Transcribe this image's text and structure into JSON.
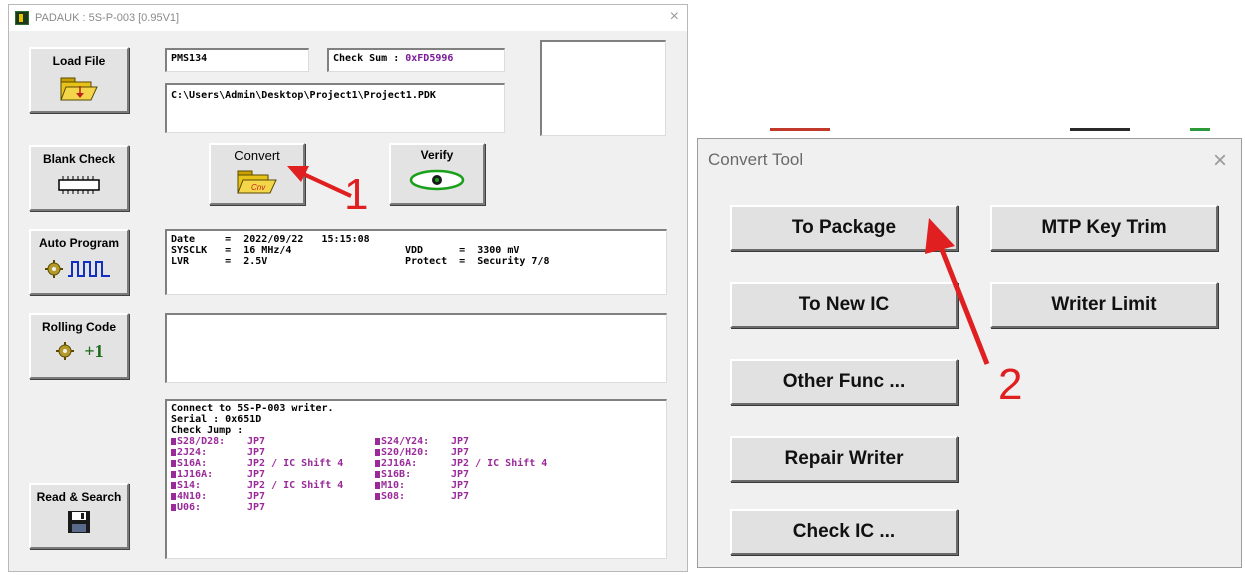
{
  "window": {
    "title": "PADAUK : 5S-P-003 [0.95V1]",
    "close_glyph": "×"
  },
  "side_buttons": {
    "load_file": "Load File",
    "blank_check": "Blank Check",
    "auto_program": "Auto Program",
    "rolling_code": "Rolling Code",
    "rolling_code_suffix": "+1",
    "read_search": "Read & Search"
  },
  "header": {
    "ic_name": "PMS134",
    "checksum_label": "Check Sum : ",
    "checksum_value": "0xFD5996",
    "file_path": "C:\\Users\\Admin\\Desktop\\Project1\\Project1.PDK"
  },
  "actions": {
    "convert": "Convert",
    "verify": "Verify"
  },
  "info": {
    "row1_left": "Date     =  2022/09/22   15:15:08",
    "row2_left": "SYSCLK   =  16 MHz/4",
    "row2_right": "VDD      =  3300 mV",
    "row3_left": "LVR      =  2.5V",
    "row3_right": "Protect  =  Security 7/8"
  },
  "log": {
    "lines": [
      "Connect to 5S-P-003 writer.",
      "Serial : 0x651D",
      "Check Jump :"
    ],
    "jumps_left": [
      {
        "pkg": "S28/D28:",
        "val": "JP7"
      },
      {
        "pkg": "2J24:",
        "val": "JP7"
      },
      {
        "pkg": "S16A:",
        "val": "JP2 / IC Shift 4"
      },
      {
        "pkg": "1J16A:",
        "val": "JP7"
      },
      {
        "pkg": "S14:",
        "val": "JP2 / IC Shift 4"
      },
      {
        "pkg": "4N10:",
        "val": "JP7"
      },
      {
        "pkg": "U06:",
        "val": "JP7"
      }
    ],
    "jumps_right": [
      {
        "pkg": "S24/Y24:",
        "val": "JP7"
      },
      {
        "pkg": "S20/H20:",
        "val": "JP7"
      },
      {
        "pkg": "2J16A:",
        "val": "JP2 / IC Shift 4"
      },
      {
        "pkg": "S16B:",
        "val": "JP7"
      },
      {
        "pkg": "M10:",
        "val": "JP7"
      },
      {
        "pkg": "S08:",
        "val": "JP7"
      }
    ]
  },
  "convert_tool": {
    "title": "Convert Tool",
    "close_glyph": "×",
    "buttons": {
      "to_package": "To Package",
      "mtp_key_trim": "MTP Key Trim",
      "to_new_ic": "To New IC",
      "writer_limit": "Writer Limit",
      "other_func": "Other Func ...",
      "repair_writer": "Repair Writer",
      "check_ic": "Check IC ..."
    }
  },
  "annotations": {
    "step1": "1",
    "step2": "2"
  },
  "colors": {
    "annotation_red": "#e02020",
    "log_purple": "#9a2a9a",
    "checksum_purple": "#7a1a9a"
  }
}
